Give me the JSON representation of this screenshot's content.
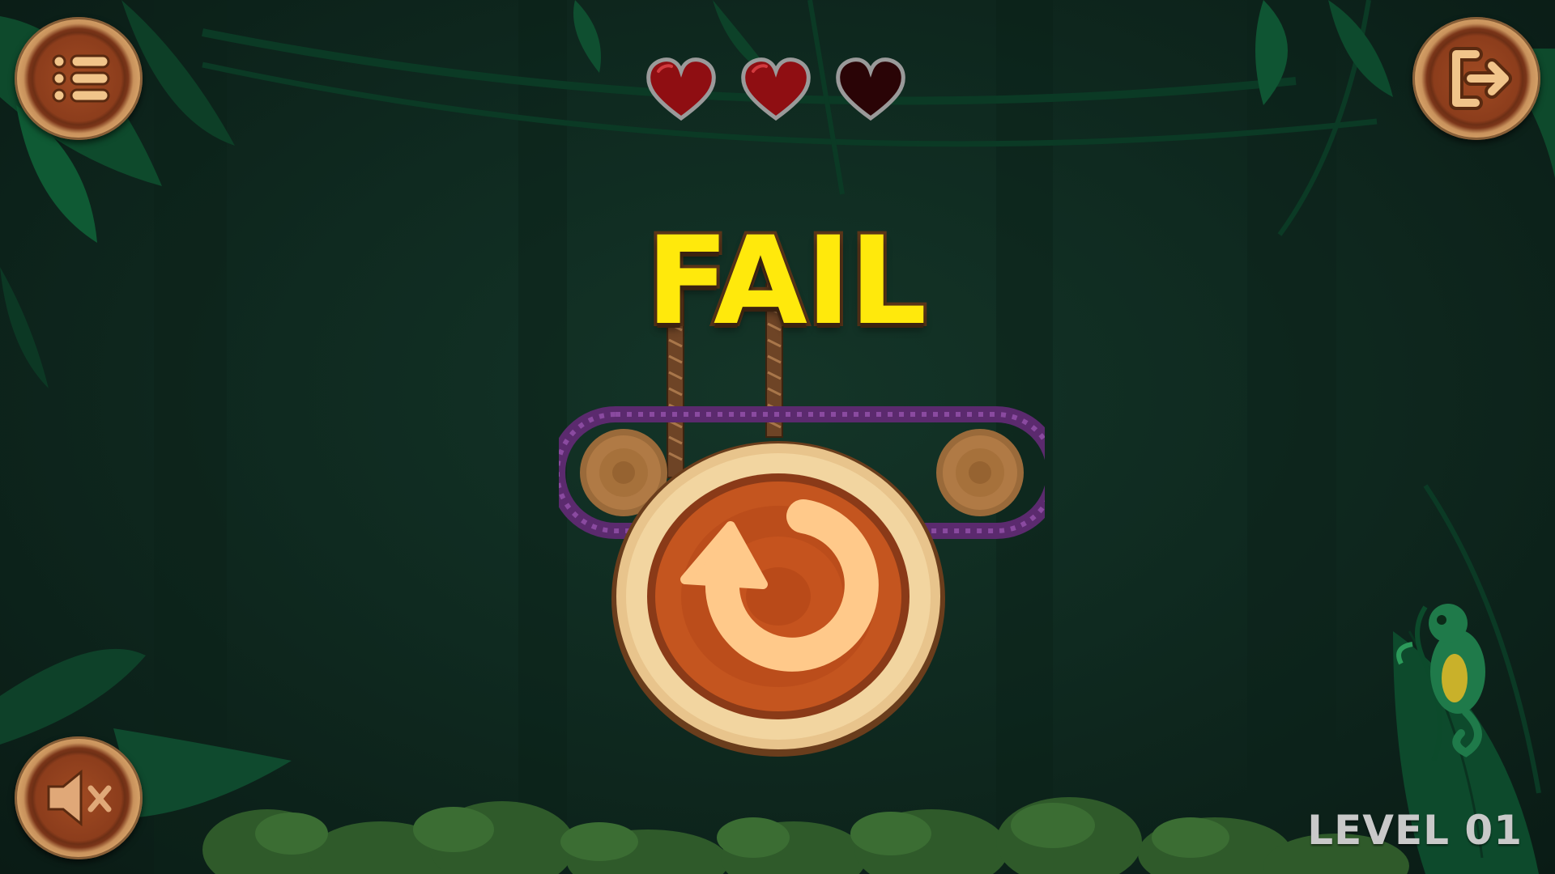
{
  "screen": {
    "status": "FAIL",
    "level_label": "LEVEL 01"
  },
  "lives": {
    "total": 3,
    "remaining": 2,
    "full_color": "#8f0e12",
    "empty_color": "#2a0406"
  },
  "buttons": {
    "menu_icon": "menu-list-icon",
    "exit_icon": "exit-door-icon",
    "sound_icon": "speaker-muted-icon",
    "replay_icon": "replay-arrow-icon"
  },
  "colors": {
    "title_fill": "#ffe90c",
    "title_outline": "#5a3519",
    "wood_light": "#dcaa6e",
    "wood_dark": "#8c3d1c",
    "rope_purple": "#5b2a6e",
    "background": "#0f2a20"
  }
}
